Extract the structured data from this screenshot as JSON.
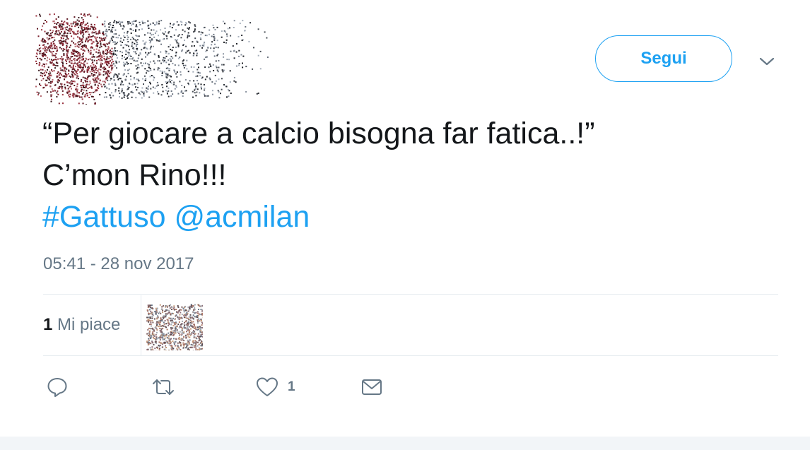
{
  "header": {
    "follow_label": "Segui"
  },
  "tweet": {
    "text_line1": "“Per giocare a calcio bisogna far fatica..!”",
    "text_line2": "C’mon Rino!!!",
    "hashtag": "#Gattuso",
    "mention": "@acmilan",
    "timestamp": "05:41 - 28 nov 2017"
  },
  "stats": {
    "likes_count": "1",
    "likes_label": "Mi piace"
  },
  "actions": {
    "like_count": "1"
  },
  "colors": {
    "accent": "#1da1f2",
    "text": "#14171a",
    "muted": "#657786",
    "divider": "#e6ecf0"
  },
  "icons": {
    "reply": "reply-icon",
    "retweet": "retweet-icon",
    "like": "heart-icon",
    "message": "envelope-icon",
    "more": "chevron-down-icon"
  }
}
